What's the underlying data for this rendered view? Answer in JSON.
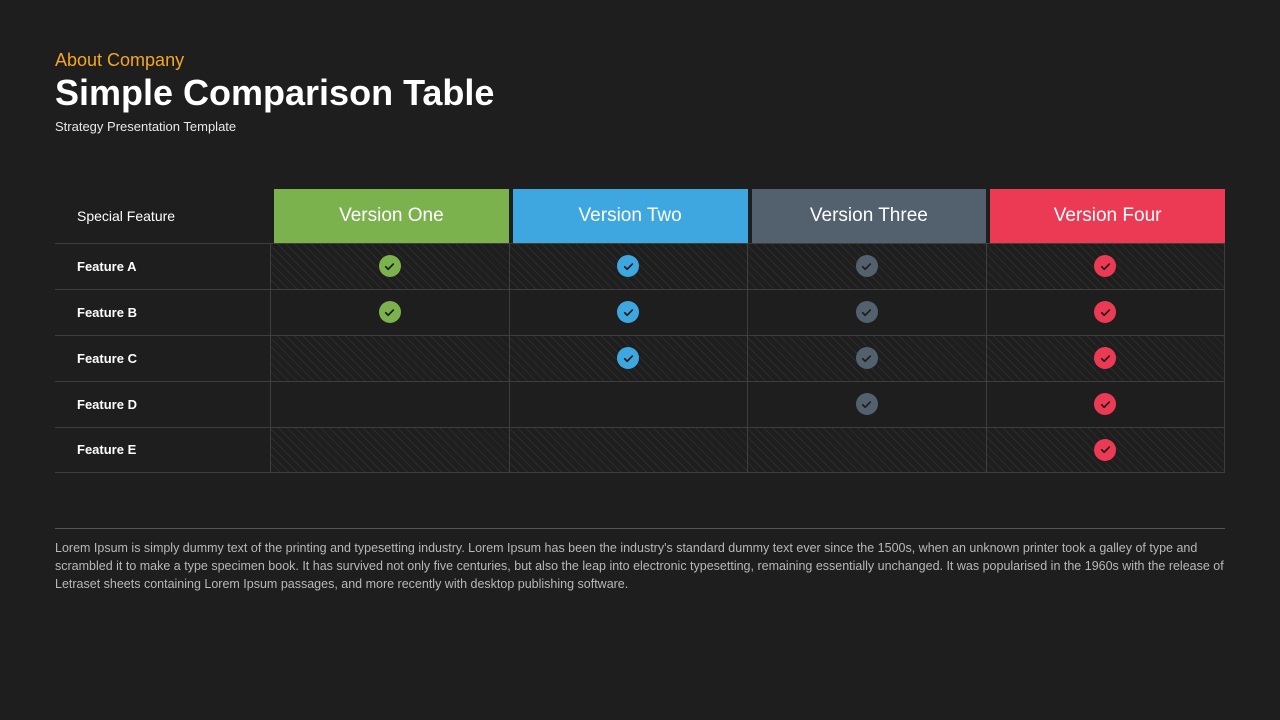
{
  "header": {
    "eyebrow": "About Company",
    "title": "Simple Comparison Table",
    "subtitle": "Strategy Presentation Template"
  },
  "table": {
    "feature_header": "Special Feature",
    "columns": [
      {
        "label": "Version One",
        "color": "#7bb24d"
      },
      {
        "label": "Version Two",
        "color": "#3fa7e0"
      },
      {
        "label": "Version Three",
        "color": "#53616f"
      },
      {
        "label": "Version Four",
        "color": "#ed3a54"
      }
    ],
    "rows": [
      {
        "feature": "Feature A",
        "cells": [
          true,
          true,
          true,
          true
        ],
        "hatched": true
      },
      {
        "feature": "Feature B",
        "cells": [
          true,
          true,
          true,
          true
        ],
        "hatched": false
      },
      {
        "feature": "Feature C",
        "cells": [
          false,
          true,
          true,
          true
        ],
        "hatched": true
      },
      {
        "feature": "Feature D",
        "cells": [
          false,
          false,
          true,
          true
        ],
        "hatched": false
      },
      {
        "feature": "Feature E",
        "cells": [
          false,
          false,
          false,
          true
        ],
        "hatched": true
      }
    ]
  },
  "footer": {
    "text": "Lorem Ipsum is simply dummy text of the printing and typesetting industry. Lorem Ipsum has been the industry's standard dummy text ever since the 1500s, when an unknown printer took a galley of type and scrambled it to make a type specimen book. It has survived not only five centuries, but also the leap into electronic typesetting, remaining essentially unchanged. It was popularised in the 1960s with the release of Letraset sheets containing Lorem Ipsum passages, and more recently with desktop publishing software."
  }
}
